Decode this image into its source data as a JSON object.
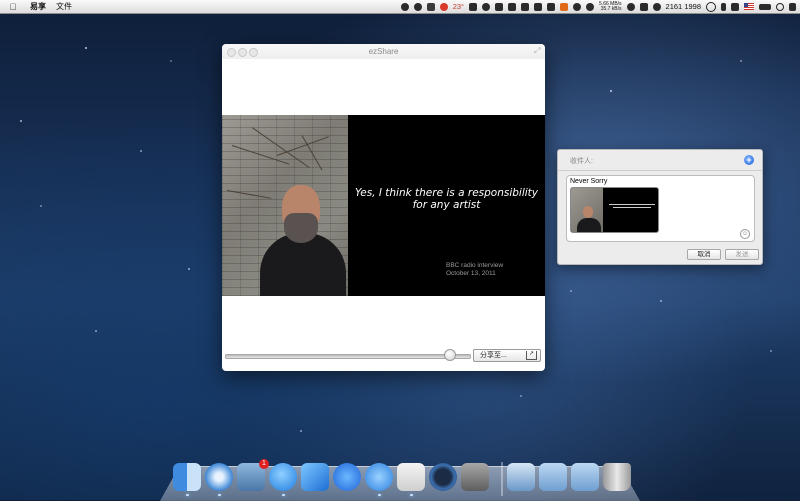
{
  "menubar": {
    "app_name": "易享",
    "menus": [
      "文件"
    ],
    "temperature": "23°",
    "net_up": "5.66 MB/s",
    "net_down": "35.7 kB/s",
    "numbers": "2161 1998"
  },
  "window": {
    "title": "ezShare",
    "slide_quote": "Yes, I think there is a responsibility for any artist",
    "slide_credit_line1": "BBC radio interview",
    "slide_credit_line2": "October 13, 2011",
    "slider_value": 0.93,
    "share_button_label": "分享至..."
  },
  "message_panel": {
    "to_label": "收件人:",
    "message_text": "Never Sorry",
    "cancel_label": "取消",
    "send_label": "发送"
  },
  "dock": {
    "items": [
      "finder-icon",
      "safari-icon",
      "mail-icon",
      "messages-icon",
      "testflight-icon",
      "appstore-icon",
      "itunes-icon",
      "stickies-icon",
      "time-machine-icon",
      "system-preferences-icon",
      "preview-icon",
      "applications-folder-icon",
      "downloads-folder-icon",
      "trash-icon"
    ],
    "mail_badge": "1"
  },
  "colors": {
    "accent_blue": "#1f63d8",
    "desktop_dark": "#10233f"
  }
}
